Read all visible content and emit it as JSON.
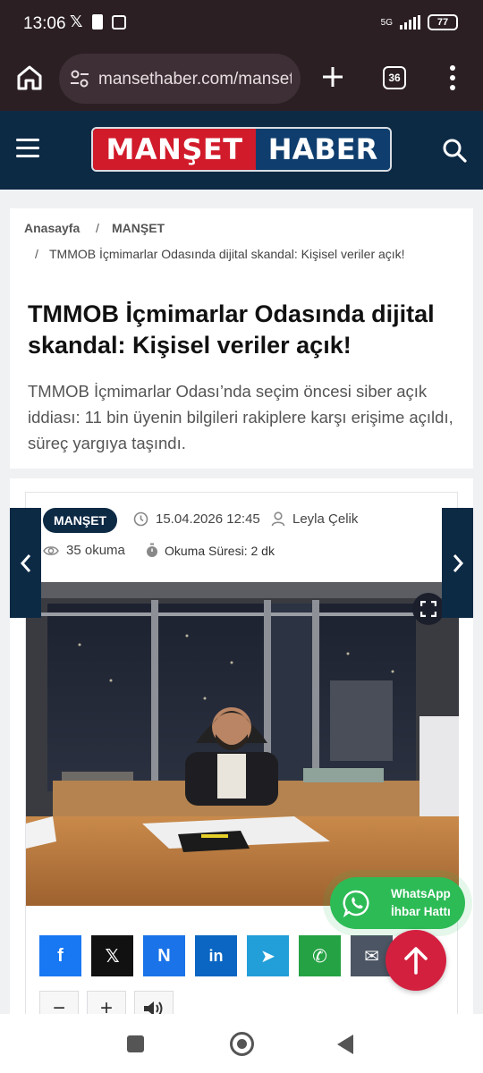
{
  "status": {
    "time": "13:06",
    "network": "5G",
    "battery": "77"
  },
  "browser": {
    "url": "mansethaber.com/manset/",
    "tab_count": "36"
  },
  "site": {
    "logo_left": "MANŞET",
    "logo_right": "HABER"
  },
  "breadcrumb": {
    "home": "Anasayfa",
    "separator": "/",
    "category": "MANŞET",
    "current": "TMMOB İçmimarlar Odasında dijital skandal: Kişisel veriler açık!"
  },
  "article": {
    "title": "TMMOB İçmimarlar Odasında dijital skandal: Kişisel veriler açık!",
    "summary": "TMMOB İçmimarlar Odası’nda seçim öncesi siber açık iddiası: 11 bin üyenin bilgileri rakiplere karşı erişime açıldı, süreç yargıya taşındı.",
    "category_badge": "MANŞET",
    "date": "15.04.2026 12:45",
    "author": "Leyla Çelik",
    "views": "35 okuma",
    "read_time": "Okuma Süresi: 2 dk"
  },
  "share": [
    {
      "name": "facebook",
      "glyph": "f",
      "color": "#1877f2"
    },
    {
      "name": "x",
      "glyph": "𝕏",
      "color": "#111111"
    },
    {
      "name": "nsosyal",
      "glyph": "N",
      "color": "#1a73e8"
    },
    {
      "name": "linkedin",
      "glyph": "in",
      "color": "#0a66c2"
    },
    {
      "name": "telegram",
      "glyph": "➤",
      "color": "#229ed9"
    },
    {
      "name": "whatsapp",
      "glyph": "✆",
      "color": "#25a244"
    },
    {
      "name": "email",
      "glyph": "✉",
      "color": "#4b5563"
    }
  ],
  "tools": {
    "font_decrease": "−",
    "font_increase": "+",
    "listen": "🔊"
  },
  "whatsapp_cta": {
    "line1": "WhatsApp",
    "line2": "İhbar Hattı"
  },
  "colors": {
    "navy": "#0d2a45",
    "red": "#d11a2a",
    "whatsapp": "#2dbb56",
    "to_top": "#d4203f"
  }
}
